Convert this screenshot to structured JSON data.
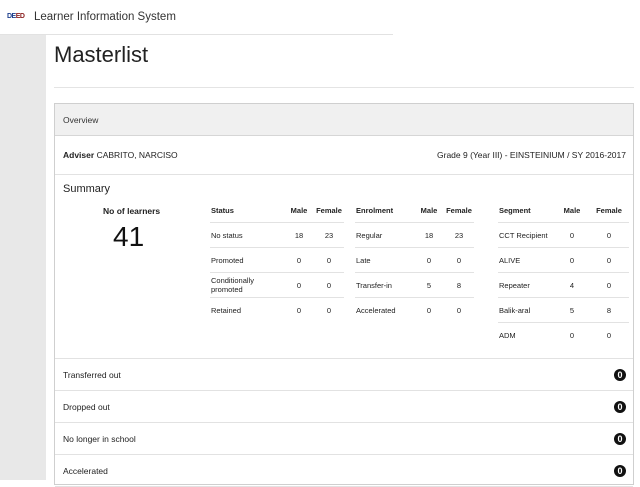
{
  "topbar": {
    "logo_text_a": "DE",
    "logo_text_b": "ED",
    "app_title": "Learner Information System"
  },
  "page_title": "Masterlist",
  "panel": {
    "header": "Overview",
    "adviser_label": "Adviser",
    "adviser_name": "CABRITO, NARCISO",
    "section_info": "Grade 9 (Year III) - EINSTEINIUM / SY 2016-2017"
  },
  "summary": {
    "title": "Summary",
    "learners_label": "No of learners",
    "learners_count": "41"
  },
  "status_table": {
    "headers": [
      "Status",
      "Male",
      "Female"
    ],
    "rows": [
      [
        "No status",
        "18",
        "23"
      ],
      [
        "Promoted",
        "0",
        "0"
      ],
      [
        "Conditionally promoted",
        "0",
        "0"
      ],
      [
        "Retained",
        "0",
        "0"
      ]
    ]
  },
  "enrolment_table": {
    "headers": [
      "Enrolment",
      "Male",
      "Female"
    ],
    "rows": [
      [
        "Regular",
        "18",
        "23"
      ],
      [
        "Late",
        "0",
        "0"
      ],
      [
        "Transfer-in",
        "5",
        "8"
      ],
      [
        "Accelerated",
        "0",
        "0"
      ]
    ]
  },
  "segment_table": {
    "headers": [
      "Segment",
      "Male",
      "Female"
    ],
    "rows": [
      [
        "CCT Recipient",
        "0",
        "0"
      ],
      [
        "ALIVE",
        "0",
        "0"
      ],
      [
        "Repeater",
        "4",
        "0"
      ],
      [
        "Balik-aral",
        "5",
        "8"
      ],
      [
        "ADM",
        "0",
        "0"
      ]
    ]
  },
  "bottom_rows": [
    {
      "label": "Transferred out",
      "count": "0"
    },
    {
      "label": "Dropped out",
      "count": "0"
    },
    {
      "label": "No longer in school",
      "count": "0"
    },
    {
      "label": "Accelerated",
      "count": "0"
    }
  ]
}
